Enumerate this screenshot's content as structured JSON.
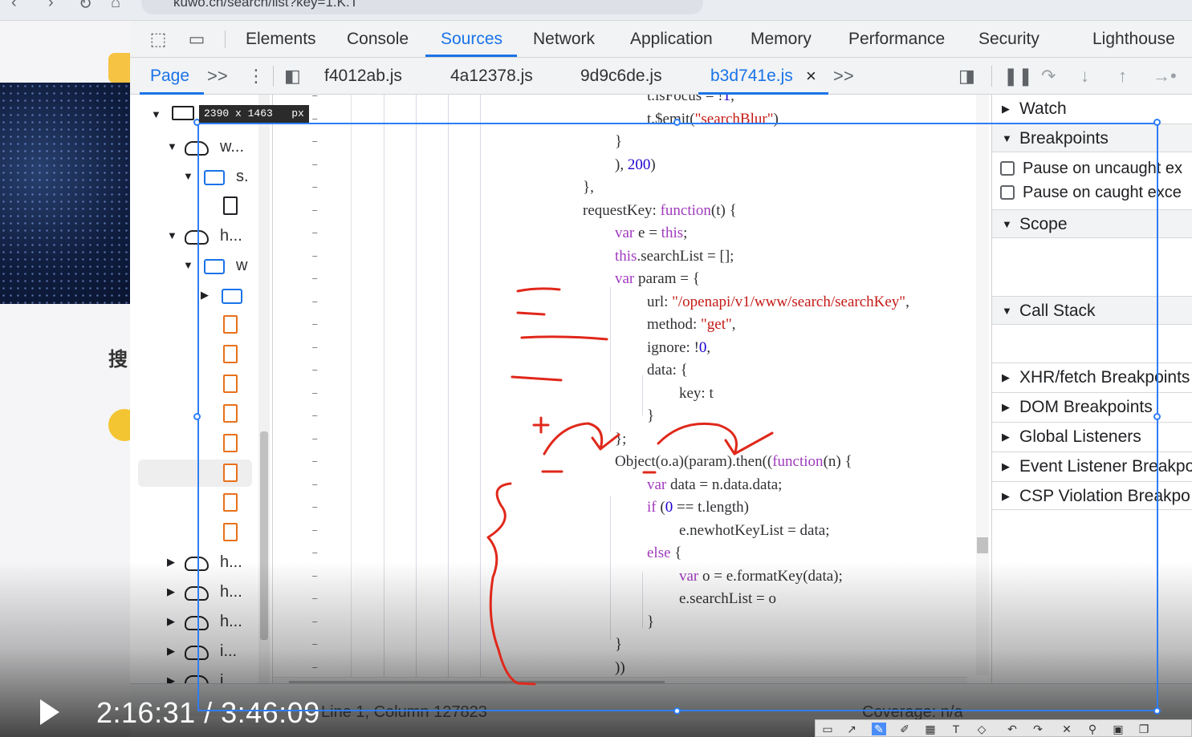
{
  "browser": {
    "url": "kuwo.cn/search/list?key=1.K.T"
  },
  "webpage": {
    "search_char": "搜"
  },
  "devtools": {
    "tabs": [
      "Elements",
      "Console",
      "Sources",
      "Network",
      "Application",
      "Memory",
      "Performance",
      "Security",
      "Lighthouse"
    ],
    "active_tab": "Sources",
    "subbar": {
      "page_label": "Page",
      "overflow": ">>",
      "files": [
        "f4012ab.js",
        "4a12378.js",
        "9d9c6de.js",
        "b3d741e.js"
      ],
      "active_file": "b3d741e.js",
      "close": "×",
      "more": ">>"
    },
    "navigator": {
      "rows": [
        {
          "label": "w..."
        },
        {
          "label": "s."
        },
        {
          "label": "h..."
        },
        {
          "label": "w"
        },
        {
          "label": "h..."
        },
        {
          "label": "h..."
        },
        {
          "label": "h..."
        },
        {
          "label": "i..."
        },
        {
          "label": "i..."
        }
      ]
    },
    "code_lines": [
      "t.isFocus = !1,",
      "t.$emit(\"searchBlur\")",
      "}",
      "), 200)",
      "},",
      "requestKey: function(t) {",
      "var e = this;",
      "this.searchList = [];",
      "var param = {",
      "url: \"/openapi/v1/www/search/searchKey\",",
      "method: \"get\",",
      "ignore: !0,",
      "data: {",
      "key: t",
      "}",
      "};",
      "Object(o.a)(param).then((function(n) {",
      "var data = n.data.data;",
      "if (0 == t.length)",
      "e.newhotKeyList = data;",
      "else {",
      "var o = e.formatKey(data);",
      "e.searchList = o",
      "}",
      "}",
      "))"
    ],
    "gutter_mark": "–",
    "sidebar": {
      "watch": "Watch",
      "breakpoints": "Breakpoints",
      "pause_uncaught": "Pause on uncaught ex",
      "pause_caught": "Pause on caught exce",
      "scope": "Scope",
      "call_stack": "Call Stack",
      "xhr": "XHR/fetch Breakpoints",
      "dom": "DOM Breakpoints",
      "global": "Global Listeners",
      "event": "Event Listener Breakpo",
      "csp": "CSP Violation Breakpo"
    },
    "status": {
      "line_col": "Line 1, Column 127823",
      "coverage": "Coverage: n/a"
    }
  },
  "overlay": {
    "size_tag": "2390 x 1463   px",
    "time": "2:16:31 / 3:46:09"
  },
  "colors": {
    "accent": "#1a73e8",
    "selection": "#2e7df6",
    "annotation": "#e0281b"
  }
}
